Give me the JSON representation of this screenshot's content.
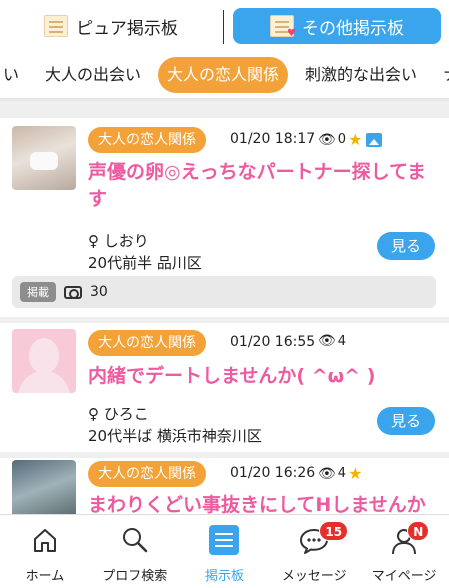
{
  "boards": {
    "pure_label": "ピュア掲示板",
    "other_label": "その他掲示板"
  },
  "categories": [
    "い",
    "大人の出会い",
    "大人の恋人関係",
    "刺激的な出会い",
    "ナ"
  ],
  "active_category_index": 2,
  "posts": [
    {
      "category": "大人の恋人関係",
      "time": "01/20 18:17",
      "views": "0",
      "starred": true,
      "has_image": true,
      "title": "声優の卵◎えっちなパートナー探してます",
      "poster_name": "♀ しおり",
      "poster_info": "20代前半 品川区",
      "view_button": "見る",
      "listed_label": "掲載",
      "photo_count": "30"
    },
    {
      "category": "大人の恋人関係",
      "time": "01/20 16:55",
      "views": "4",
      "starred": false,
      "has_image": false,
      "title": "内緒でデートしませんか( ^ω^ )",
      "poster_name": "♀ ひろこ",
      "poster_info": "20代半ば 横浜市神奈川区",
      "view_button": "見る"
    },
    {
      "category": "大人の恋人関係",
      "time": "01/20 16:26",
      "views": "4",
      "starred": true,
      "has_image": false,
      "title": "まわりくどい事抜きにしてHしませんか",
      "poster_name": "♀",
      "poster_info": ""
    }
  ],
  "nav": {
    "home": "ホーム",
    "profile_search": "プロフ検索",
    "board": "掲示板",
    "messages": "メッセージ",
    "messages_badge": "15",
    "mypage": "マイページ",
    "mypage_badge": "N"
  },
  "colors": {
    "accent_blue": "#3aa5ec",
    "category_orange": "#f3a23a",
    "title_pink": "#ee5aa0",
    "badge_red": "#e4302b"
  }
}
